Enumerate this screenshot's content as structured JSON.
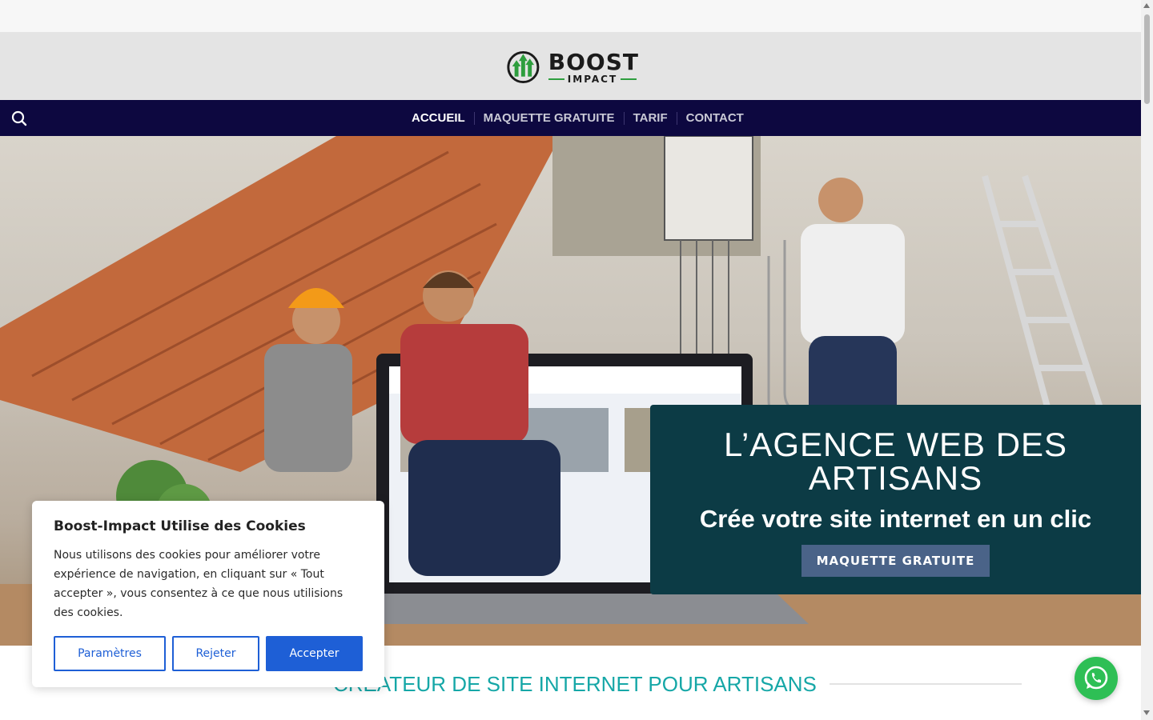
{
  "header": {
    "logo": {
      "word1": "BOOST",
      "word2": "IMPACT"
    }
  },
  "nav": {
    "items": [
      {
        "label": "ACCUEIL",
        "active": true
      },
      {
        "label": "MAQUETTE GRATUITE",
        "active": false
      },
      {
        "label": "TARIF",
        "active": false
      },
      {
        "label": "CONTACT",
        "active": false
      }
    ]
  },
  "hero": {
    "title": "L’AGENCE WEB DES ARTISANS",
    "subtitle": "Crée votre site internet en un clic",
    "cta_label": "MAQUETTE GRATUITE"
  },
  "section": {
    "title": "CRÉATEUR DE SITE INTERNET POUR ARTISANS"
  },
  "cookie_banner": {
    "title": "Boost-Impact Utilise des Cookies",
    "text": "Nous utilisons des cookies pour améliorer votre expérience de navigation, en cliquant sur « Tout accepter », vous consentez à ce que nous utilisions des cookies.",
    "settings_label": "Paramètres",
    "reject_label": "Rejeter",
    "accept_label": "Accepter"
  },
  "colors": {
    "nav_bg": "#0d0840",
    "hero_box_bg": "#0c3b45",
    "cta_bg": "#4a6388",
    "section_title": "#16a7a7",
    "cookie_accent": "#1e5fd6",
    "whatsapp": "#2ebf55"
  },
  "icons": {
    "search": "search-icon",
    "whatsapp": "whatsapp-icon"
  }
}
